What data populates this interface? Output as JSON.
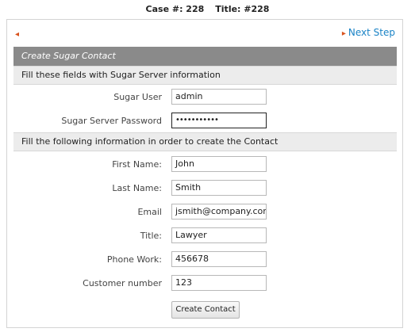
{
  "header": {
    "case_label": "Case #: 228",
    "title_label": "Title: #228"
  },
  "nav": {
    "back_icon": "◂",
    "next_label": "Next Step",
    "next_icon": "▸"
  },
  "form": {
    "title": "Create Sugar Contact",
    "section1": "Fill these fields with Sugar Server information",
    "section2": "Fill the following information in order to create the Contact",
    "sugar_user_label": "Sugar User",
    "sugar_user_value": "admin",
    "password_label": "Sugar Server Password",
    "password_value": "•••••••••••",
    "first_name_label": "First Name:",
    "first_name_value": "John",
    "last_name_label": "Last Name:",
    "last_name_value": "Smith",
    "email_label": "Email",
    "email_value": "jsmith@company.com",
    "title_label": "Title:",
    "title_value": "Lawyer",
    "phone_label": "Phone Work:",
    "phone_value": "456678",
    "customer_label": "Customer number",
    "customer_value": "123",
    "submit_label": "Create Contact"
  }
}
